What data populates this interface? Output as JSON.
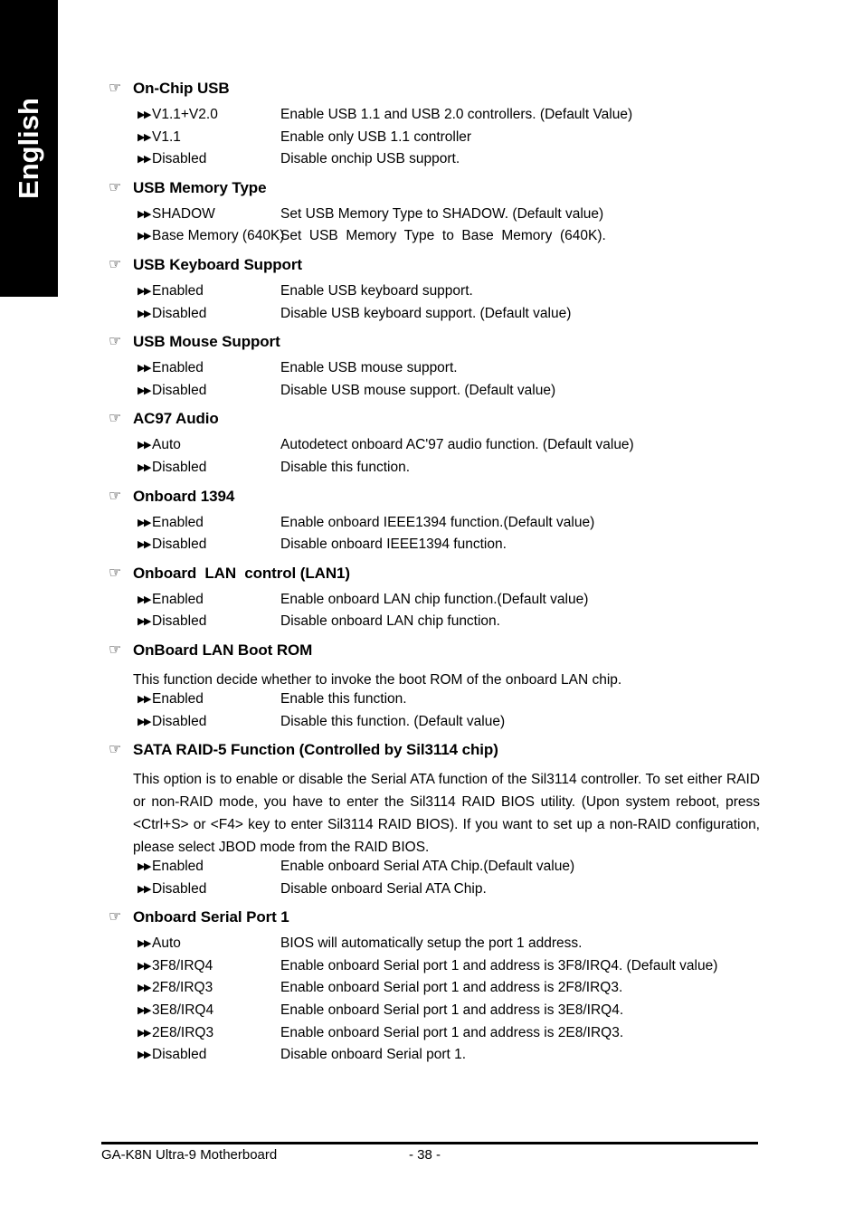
{
  "sidebar": {
    "language_label": "English"
  },
  "icons": {
    "hand": "☞",
    "double_arrow": "▶▶"
  },
  "sections": [
    {
      "title": "On-Chip USB",
      "note": "",
      "options": [
        {
          "value": "V1.1+V2.0",
          "desc": "Enable USB 1.1 and USB 2.0 controllers. (Default Value)"
        },
        {
          "value": "V1.1",
          "desc": "Enable only USB 1.1 controller"
        },
        {
          "value": "Disabled",
          "desc": "Disable onchip USB support."
        }
      ]
    },
    {
      "title": "USB Memory Type",
      "note": "",
      "options": [
        {
          "value": "SHADOW",
          "desc": "Set USB Memory Type to SHADOW. (Default value)"
        },
        {
          "value": "Base Memory (640K)",
          "desc": "Set  USB  Memory  Type  to  Base  Memory  (640K)."
        }
      ]
    },
    {
      "title": "USB Keyboard Support",
      "note": "",
      "options": [
        {
          "value": "Enabled",
          "desc": "Enable USB keyboard support."
        },
        {
          "value": "Disabled",
          "desc": "Disable USB keyboard support. (Default value)"
        }
      ]
    },
    {
      "title": "USB Mouse Support",
      "note": "",
      "options": [
        {
          "value": "Enabled",
          "desc": "Enable USB mouse support."
        },
        {
          "value": "Disabled",
          "desc": "Disable USB mouse support. (Default value)"
        }
      ]
    },
    {
      "title": "AC97 Audio",
      "note": "",
      "options": [
        {
          "value": "Auto",
          "desc": "Autodetect onboard AC'97 audio function. (Default value)"
        },
        {
          "value": "Disabled",
          "desc": "Disable this function."
        }
      ]
    },
    {
      "title": "Onboard 1394",
      "note": "",
      "options": [
        {
          "value": "Enabled",
          "desc": "Enable onboard IEEE1394 function.(Default value)"
        },
        {
          "value": "Disabled",
          "desc": "Disable onboard IEEE1394 function."
        }
      ]
    },
    {
      "title": "Onboard  LAN  control (LAN1)",
      "note": "",
      "options": [
        {
          "value": "Enabled",
          "desc": "Enable onboard LAN chip function.(Default value)"
        },
        {
          "value": "Disabled",
          "desc": "Disable onboard LAN chip function."
        }
      ]
    },
    {
      "title": "OnBoard LAN Boot ROM",
      "note": "This function decide whether to invoke the boot ROM of the onboard LAN chip.",
      "options": [
        {
          "value": "Enabled",
          "desc": "Enable this function."
        },
        {
          "value": "Disabled",
          "desc": "Disable this function. (Default value)"
        }
      ]
    },
    {
      "title": "SATA RAID-5 Function (Controlled by Sil3114 chip)",
      "note": "This option is to enable or disable the Serial ATA function of the Sil3114 controller. To set either RAID or non-RAID mode, you have to enter the Sil3114 RAID BIOS utility. (Upon system reboot, press <Ctrl+S> or <F4> key to enter Sil3114 RAID BIOS). If you want to set up a non-RAID configuration, please select JBOD mode from the RAID BIOS.",
      "options": [
        {
          "value": "Enabled",
          "desc": "Enable onboard Serial ATA Chip.(Default value)"
        },
        {
          "value": "Disabled",
          "desc": "Disable onboard Serial ATA Chip."
        }
      ]
    },
    {
      "title": "Onboard Serial Port 1",
      "note": "",
      "options": [
        {
          "value": "Auto",
          "desc": "BIOS will automatically setup the port 1 address."
        },
        {
          "value": "3F8/IRQ4",
          "desc": "Enable onboard Serial port 1 and address is 3F8/IRQ4. (Default value)"
        },
        {
          "value": "2F8/IRQ3",
          "desc": "Enable onboard Serial port 1 and address is 2F8/IRQ3."
        },
        {
          "value": "3E8/IRQ4",
          "desc": "Enable onboard Serial port 1 and address is 3E8/IRQ4."
        },
        {
          "value": "2E8/IRQ3",
          "desc": "Enable onboard Serial port 1 and address is 2E8/IRQ3."
        },
        {
          "value": "Disabled",
          "desc": "Disable onboard Serial port 1."
        }
      ]
    }
  ],
  "footer": {
    "product": "GA-K8N Ultra-9 Motherboard",
    "page_number": "- 38 -"
  }
}
